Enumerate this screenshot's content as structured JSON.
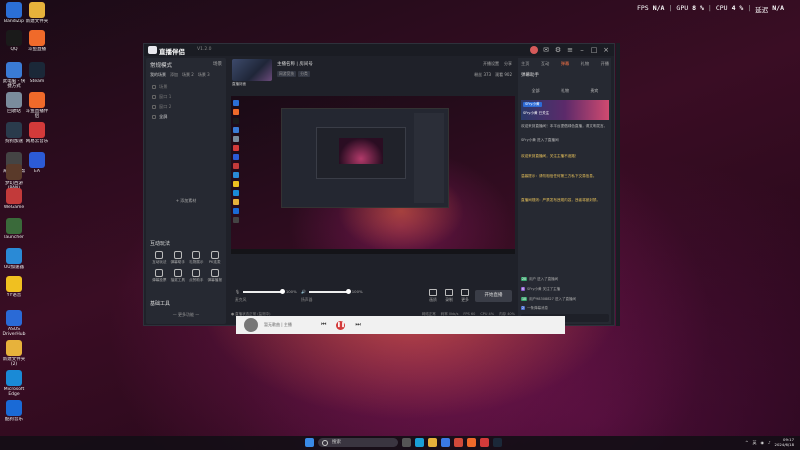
{
  "hud": {
    "fps_label": "FPS",
    "fps_value": "N/A",
    "gpu_label": "GPU",
    "gpu_value": "8 %",
    "cpu_label": "CPU",
    "cpu_value": "4 %",
    "latency_label": "延迟",
    "latency_value": "N/A"
  },
  "desktop": {
    "icons": [
      {
        "label": "BandiZip",
        "color": "#2b6fd6"
      },
      {
        "label": "新建文件夹",
        "color": "#e7b23b"
      },
      {
        "label": "QQ",
        "color": "#1a1a1a"
      },
      {
        "label": "斗鱼直播",
        "color": "#f06a2a"
      },
      {
        "label": "此电脑 - 快捷方式",
        "color": "#3a7bd5"
      },
      {
        "label": "Steam",
        "color": "#1b2838"
      },
      {
        "label": "回收站",
        "color": "#7a8c9c"
      },
      {
        "label": "斗鱼直播伴侣",
        "color": "#f06a2a"
      },
      {
        "label": "狗狗加速",
        "color": "#2a3b4c"
      },
      {
        "label": "网易云音乐",
        "color": "#d33a3a"
      },
      {
        "label": "海康云台帮助手",
        "color": "#444"
      },
      {
        "label": "梦幻西游 (PAN)",
        "color": "#5a3a2a"
      },
      {
        "label": "EA",
        "color": "#2c5bd6"
      },
      {
        "label": "WeGame",
        "color": "#c23a3a"
      },
      {
        "label": "launcher",
        "color": "#3a6a3a"
      },
      {
        "label": "UU加速器",
        "color": "#2a8ad6"
      },
      {
        "label": "YY语音",
        "color": "#f0c020"
      },
      {
        "label": "ASUS DriverHub",
        "color": "#2a6ad6"
      },
      {
        "label": "新建文件夹 (2)",
        "color": "#e7b23b"
      },
      {
        "label": "Microsoft Edge",
        "color": "#1a8ad6"
      },
      {
        "label": "酷狗音乐",
        "color": "#1a6ad6"
      }
    ]
  },
  "app": {
    "name": "直播伴侣",
    "version": "V1.2.0",
    "sidebar": {
      "header": "常规模式",
      "right_label": "场景",
      "tabs": [
        "我的场景",
        "添加",
        "场景 2",
        "场景 3"
      ],
      "scenes": [
        "场景",
        "窗口 1",
        "窗口 2",
        "全屏"
      ],
      "add_source": "+ 添加素材",
      "interaction_title": "互动玩法",
      "interaction_tools": [
        "互动玩法",
        "弹幕助手",
        "礼物展示",
        "PK连麦",
        "弹幕投票",
        "抽奖工具",
        "点赞助手",
        "弹幕播报"
      ],
      "basic_title": "基础工具",
      "basic_tools": [
        "场景中心",
        "美颜滤镜",
        "直播回放",
        "直播设置",
        "数据统计",
        "虚拟背景",
        "画面标记",
        "开播提醒"
      ],
      "more": "— 更多功能 —"
    },
    "stream": {
      "thumb_caption": "直播封面",
      "title": "主播名称  |  房间号",
      "category": [
        "网游竞技",
        "分类"
      ],
      "right_actions": [
        "开播设置",
        "分享"
      ],
      "stats": [
        "粉丝 373",
        "观看 902"
      ]
    },
    "audio": {
      "mic_label": "麦克风",
      "mic_value": "100%",
      "mic_level": 100,
      "speaker_label": "扬声器",
      "speaker_value": "100%",
      "speaker_level": 100
    },
    "right_tools": [
      "画质",
      "录制",
      "更多"
    ],
    "go_live": "开始直播",
    "status": {
      "left": "● 直播状态正常 (监测中)",
      "right": [
        "网络正常",
        "码率 0kb/s",
        "FPS 60",
        "CPU 4%",
        "内存 40%"
      ]
    },
    "right_panel": {
      "tabs": [
        "主页",
        "互动",
        "弹幕",
        "礼物",
        "开播"
      ],
      "active_tab": "弹幕",
      "sub_title": "弹幕助手",
      "subtabs": [
        "全部",
        "礼物",
        "贵宾"
      ],
      "banner_tag": "SFry小黄",
      "banner_text": "SFry小黄 已关注",
      "lines": [
        "欢迎来到直播间！本平台提倡绿色直播，请文明发言。",
        "SFry小黄 进入了直播间",
        "欢迎来到直播间，关注主播不迷路！",
        "温馨提示：请勿相信任何第三方私下交易信息。",
        "直播间规则：严禁发布违规内容，违者将被封禁。"
      ],
      "chat": [
        {
          "badge": "20",
          "text": "用户 进入了直播间"
        },
        {
          "badge": "6",
          "text": "SFry小黄 关注了主播"
        },
        {
          "badge": "10",
          "text": "用户98308827 进入了直播间"
        },
        {
          "badge": "2",
          "text": "一条弹幕消息"
        }
      ]
    }
  },
  "player": {
    "song": "暂无歌曲 | 主播",
    "prev": "⏮",
    "play": "❚❚",
    "next": "⏭"
  },
  "taskbar": {
    "search_placeholder": "搜索",
    "icons": [
      {
        "name": "start",
        "color": "#3a8ae6"
      },
      {
        "name": "task-view",
        "color": "#555"
      },
      {
        "name": "edge",
        "color": "#1aa0d6"
      },
      {
        "name": "explorer",
        "color": "#e7b23b"
      },
      {
        "name": "store",
        "color": "#3a7ae6"
      },
      {
        "name": "app1",
        "color": "#d14a3a"
      },
      {
        "name": "app2",
        "color": "#f06a2a"
      },
      {
        "name": "netease",
        "color": "#d33a3a"
      },
      {
        "name": "steam",
        "color": "#1b2838"
      }
    ],
    "tray_lang": "英",
    "time": "09:17",
    "date": "2024/6/18"
  }
}
